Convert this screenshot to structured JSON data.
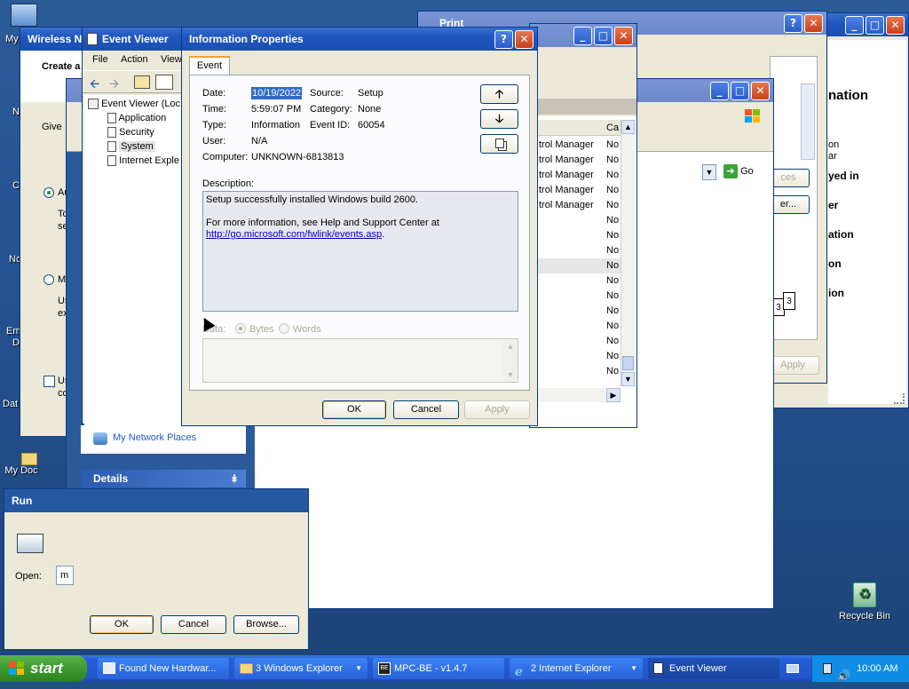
{
  "desktop": {
    "left_labels": [
      "My",
      "N",
      "C",
      "No",
      "Em",
      "D",
      "Dat",
      "My Doc"
    ],
    "recycle_bin": "Recycle Bin"
  },
  "print_window": {
    "title": "Print",
    "apply": "Apply",
    "pages": [
      "3",
      "3"
    ]
  },
  "wireless_window": {
    "title": "Wireless Ne",
    "heading": "Create a",
    "give": "Give",
    "opt_auto": "Au",
    "opt_auto_desc": [
      "To",
      "se"
    ],
    "opt_manual": "M",
    "opt_manual_desc": [
      "Us",
      "ex"
    ],
    "check_label": [
      "Us",
      "co"
    ]
  },
  "right_window": {
    "texts": [
      "nation",
      "on",
      "ar",
      "yed in",
      "er",
      "ation",
      "on",
      "ion"
    ],
    "button_label": "er...",
    "button2_label": "ces"
  },
  "explorer_window": {
    "go": "Go",
    "col_header": "Ca",
    "left_col": [
      "trol Manager",
      "trol Manager",
      "trol Manager",
      "trol Manager",
      "trol Manager"
    ],
    "right_col": [
      "No",
      "No",
      "No",
      "No",
      "No",
      "No",
      "No",
      "No",
      "No",
      "No",
      "No",
      "No",
      "No",
      "No",
      "No",
      "No"
    ],
    "network_places": "My Network Places",
    "details": "Details"
  },
  "event_viewer": {
    "title": "Event Viewer",
    "menu": [
      "File",
      "Action",
      "View"
    ],
    "tree_root": "Event Viewer (Loc",
    "tree": [
      "Application",
      "Security",
      "System",
      "Internet Exple"
    ]
  },
  "run_dialog": {
    "title": "Run",
    "open_label": "Open:",
    "open_value": "m",
    "ok": "OK",
    "cancel": "Cancel",
    "browse": "Browse..."
  },
  "info_dialog": {
    "title": "Information Properties",
    "tab": "Event",
    "labels": {
      "date": "Date:",
      "time": "Time:",
      "type": "Type:",
      "user": "User:",
      "computer": "Computer:",
      "source": "Source:",
      "category": "Category:",
      "event_id": "Event ID:"
    },
    "values": {
      "date": "10/19/2022",
      "time": "5:59:07 PM",
      "type": "Information",
      "user": "N/A",
      "computer": "UNKNOWN-6813813",
      "source": "Setup",
      "category": "None",
      "event_id": "60054"
    },
    "description_label": "Description:",
    "description_line1": "Setup successfully installed Windows build 2600.",
    "description_line2": "For more information, see Help and Support Center at",
    "description_link": "http://go.microsoft.com/fwlink/events.asp",
    "description_dot": ".",
    "data_label": "Data:",
    "bytes": "Bytes",
    "words": "Words",
    "ok": "OK",
    "cancel": "Cancel",
    "apply": "Apply"
  },
  "taskbar": {
    "start": "start",
    "tasks": [
      "Found New Hardwar...",
      "3 Windows Explorer",
      "MPC-BE - v1.4.7",
      "2 Internet Explorer",
      "Event Viewer"
    ],
    "clock": "10:00 AM"
  },
  "colors": {
    "titlebar": "#1f56bf",
    "desktop": "#245190",
    "dialog": "#ece9d8",
    "selection": "#316ac5"
  }
}
